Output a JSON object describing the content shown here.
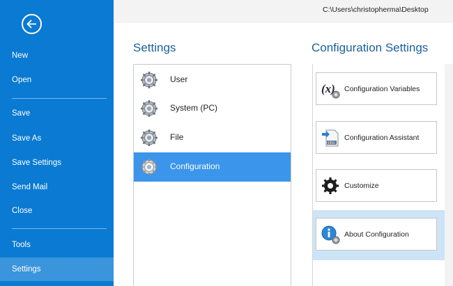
{
  "path": "C:\\Users\\christopherma\\Desktop",
  "nav": {
    "back_label": "",
    "items": [
      {
        "label": "New"
      },
      {
        "label": "Open"
      },
      {
        "label": "Save"
      },
      {
        "label": "Save As"
      },
      {
        "label": "Save Settings"
      },
      {
        "label": "Send Mail"
      },
      {
        "label": "Close"
      },
      {
        "label": "Tools"
      },
      {
        "label": "Settings"
      }
    ]
  },
  "settings": {
    "title": "Settings",
    "items": [
      {
        "label": "User"
      },
      {
        "label": "System (PC)"
      },
      {
        "label": "File"
      },
      {
        "label": "Configuration"
      }
    ],
    "selected": "Configuration"
  },
  "config": {
    "title": "Configuration Settings",
    "cards": [
      {
        "label": "Configuration Variables",
        "icon": "variable-x-icon"
      },
      {
        "label": "Configuration Assistant",
        "icon": "cfg-assistant-icon"
      },
      {
        "label": "Customize",
        "icon": "gear-customize-icon"
      },
      {
        "label": "About Configuration",
        "icon": "info-gear-icon"
      }
    ]
  },
  "colors": {
    "nav_bg": "#0a7ad2",
    "nav_active": "#3b95dc",
    "list_selected": "#3b95ea",
    "heading": "#1a5f9c",
    "card_selected_bg": "#cde4f7"
  }
}
